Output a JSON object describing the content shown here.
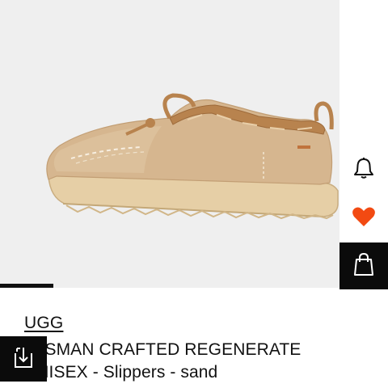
{
  "product": {
    "brand": "UGG",
    "title_line_1": "TASMAN CRAFTED REGENERATE",
    "title_line_2": "UNISEX - Slippers - sand",
    "image_subject": "sand suede slipper with leather lace trim"
  },
  "gallery": {
    "progress_fraction": 0.16
  },
  "actions": {
    "notify_icon": "bell-icon",
    "wishlist_icon": "heart-icon",
    "wishlist_color": "#f24a12",
    "bag_icon": "shopping-bag-icon",
    "compare_icon": "compare-icon"
  },
  "colors": {
    "image_background": "#efefef",
    "dark_button": "#0b0b0b"
  }
}
